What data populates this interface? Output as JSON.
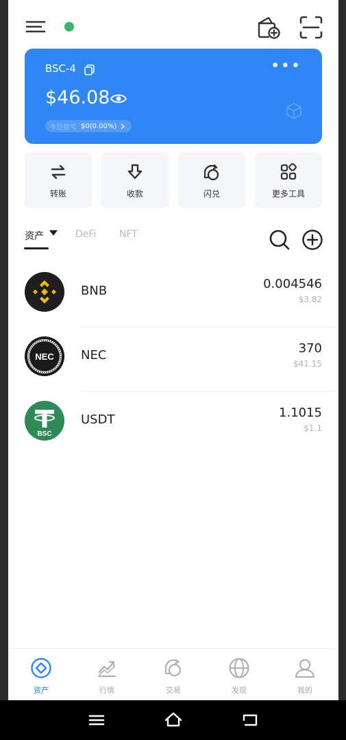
{
  "header": {
    "menu_icon": "menu-icon",
    "status_dot_color": "#3cb371",
    "wallet_add_icon": "wallet-add-icon",
    "scan_icon": "scan-icon"
  },
  "card": {
    "network": "BSC-4",
    "balance": "$46.08",
    "pill_label": "今日盈亏",
    "pill_value": "$0(0.00%)",
    "more": "•••",
    "color": "#2f86f5"
  },
  "actions": [
    {
      "label": "转账",
      "icon": "transfer-icon"
    },
    {
      "label": "收款",
      "icon": "receive-icon"
    },
    {
      "label": "闪兑",
      "icon": "swap-icon"
    },
    {
      "label": "更多工具",
      "icon": "more-tools-icon"
    }
  ],
  "tabs": [
    {
      "label": "资产",
      "active": true
    },
    {
      "label": "DeFi",
      "active": false
    },
    {
      "label": "NFT",
      "active": false
    }
  ],
  "assets": [
    {
      "symbol": "BNB",
      "amount": "0.004546",
      "usd": "$3.82"
    },
    {
      "symbol": "NEC",
      "amount": "370",
      "usd": "$41.15",
      "logo_text": "NEC"
    },
    {
      "symbol": "USDT",
      "amount": "1.1015",
      "usd": "$1.1",
      "logo_text": "BSC"
    }
  ],
  "nav": [
    {
      "label": "资产",
      "icon": "assets-icon",
      "active": true
    },
    {
      "label": "行情",
      "icon": "market-icon",
      "active": false
    },
    {
      "label": "交易",
      "icon": "trade-icon",
      "active": false
    },
    {
      "label": "发现",
      "icon": "discover-icon",
      "active": false
    },
    {
      "label": "我的",
      "icon": "profile-icon",
      "active": false
    }
  ]
}
